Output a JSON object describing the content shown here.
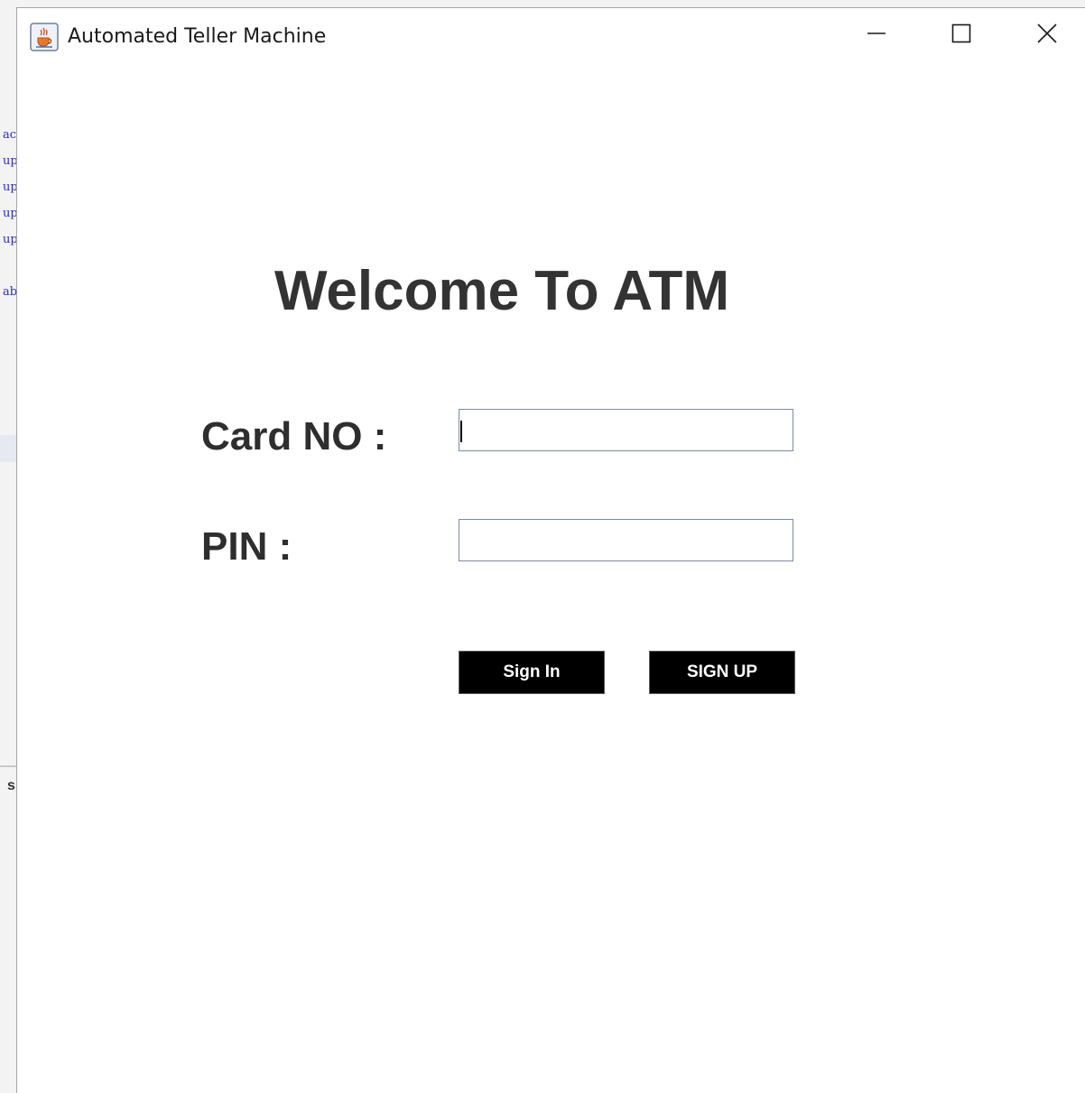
{
  "window": {
    "title": "Automated Teller Machine",
    "controls": {
      "minimize": "minimize-icon",
      "maximize": "maximize-icon",
      "close": "close-icon"
    }
  },
  "main": {
    "heading": "Welcome To ATM",
    "card_label": "Card NO :",
    "card_value": "",
    "pin_label": "PIN :",
    "pin_value": "",
    "signin_label": "Sign In",
    "signup_label": "SIGN UP"
  },
  "colors": {
    "button_bg": "#000000",
    "button_text": "#ffffff",
    "heading_text": "#333333",
    "input_border": "#7a8aa6"
  }
}
